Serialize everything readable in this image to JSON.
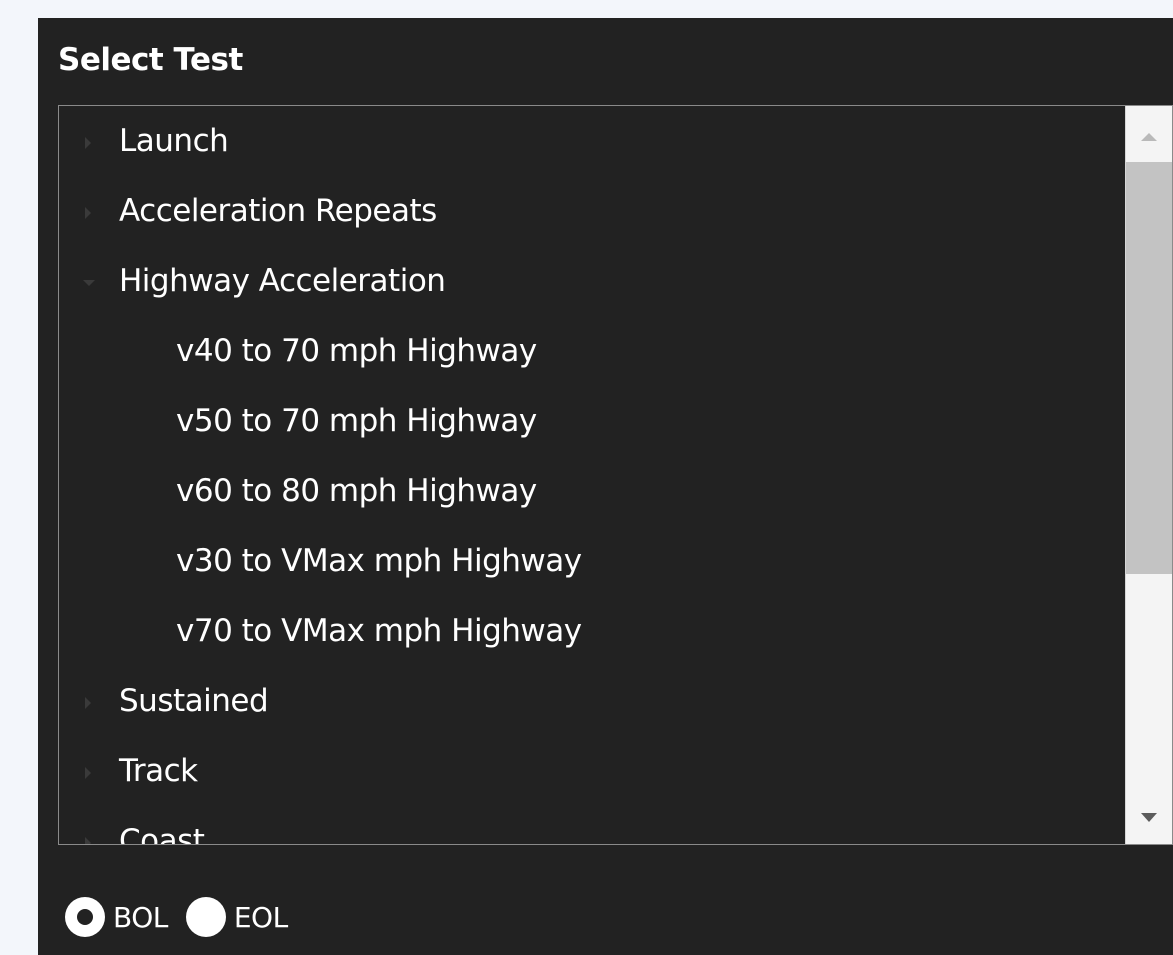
{
  "panel": {
    "title": "Select Test"
  },
  "tree": {
    "items": [
      {
        "label": "Launch",
        "level": 0,
        "state": "collapsed"
      },
      {
        "label": "Acceleration Repeats",
        "level": 0,
        "state": "collapsed"
      },
      {
        "label": "Highway Acceleration",
        "level": 0,
        "state": "expanded"
      },
      {
        "label": "v40 to 70 mph Highway",
        "level": 1,
        "state": "leaf"
      },
      {
        "label": "v50 to 70 mph Highway",
        "level": 1,
        "state": "leaf"
      },
      {
        "label": "v60 to 80 mph Highway",
        "level": 1,
        "state": "leaf"
      },
      {
        "label": "v30 to VMax mph Highway",
        "level": 1,
        "state": "leaf"
      },
      {
        "label": "v70 to VMax mph Highway",
        "level": 1,
        "state": "leaf"
      },
      {
        "label": "Sustained",
        "level": 0,
        "state": "collapsed"
      },
      {
        "label": "Track",
        "level": 0,
        "state": "collapsed"
      },
      {
        "label": "Coast",
        "level": 0,
        "state": "collapsed"
      }
    ]
  },
  "mode": {
    "options": [
      {
        "label": "BOL",
        "checked": true
      },
      {
        "label": "EOL",
        "checked": false
      }
    ]
  },
  "colors": {
    "panel_background": "#222222",
    "page_background": "#f3f6fb",
    "text": "#ffffff"
  }
}
